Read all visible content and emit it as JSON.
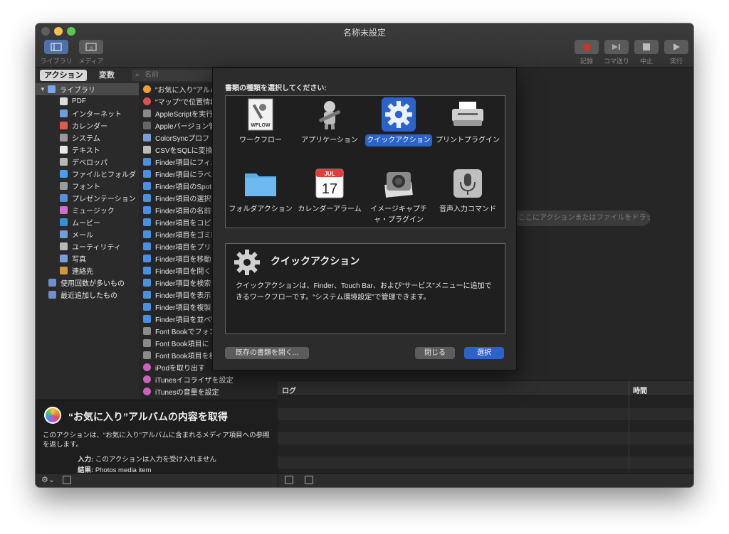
{
  "window": {
    "title": "名称未設定"
  },
  "toolbar": {
    "library_label": "ライブラリ",
    "media_label": "メディア",
    "record_label": "記録",
    "step_label": "コマ送り",
    "stop_label": "中止",
    "run_label": "実行"
  },
  "sidebar": {
    "tab_actions": "アクション",
    "tab_variables": "変数",
    "search_placeholder": "名前",
    "library": [
      {
        "label": "ライブラリ",
        "color": "#7aa6e8"
      },
      {
        "label": "PDF",
        "color": "#dddddd"
      },
      {
        "label": "インターネット",
        "color": "#6f9fd8"
      },
      {
        "label": "カレンダー",
        "color": "#e05a4f"
      },
      {
        "label": "システム",
        "color": "#9a9a9a"
      },
      {
        "label": "テキスト",
        "color": "#e8e8e8"
      },
      {
        "label": "デベロッパ",
        "color": "#b8b8b8"
      },
      {
        "label": "ファイルとフォルダ",
        "color": "#4aa0e8"
      },
      {
        "label": "フォント",
        "color": "#9a9a9a"
      },
      {
        "label": "プレゼンテーション",
        "color": "#5b8fd0"
      },
      {
        "label": "ミュージック",
        "color": "#d06fd0"
      },
      {
        "label": "ムービー",
        "color": "#3a8fd0"
      },
      {
        "label": "メール",
        "color": "#6f9fd8"
      },
      {
        "label": "ユーティリティ",
        "color": "#b8b8b8"
      },
      {
        "label": "写真",
        "color": "#7a9fd8"
      },
      {
        "label": "連絡先",
        "color": "#c89a4a"
      },
      {
        "label": "使用回数が多いもの",
        "color": "#6f8fc8"
      },
      {
        "label": "最近追加したもの",
        "color": "#6f8fc8"
      }
    ],
    "actions": [
      "\"お気に入り\"アルバ",
      "\"マップ\"で位置情報",
      "AppleScriptを実行",
      "Appleバージョン管",
      "ColorSyncプロフ",
      "CSVをSQLに変換",
      "Finder項目にフィル",
      "Finder項目にラベル",
      "Finder項目のSpot",
      "Finder項目の選択を",
      "Finder項目の名前を",
      "Finder項目をコピー",
      "Finder項目をゴミ箱",
      "Finder項目をプリン",
      "Finder項目を移動",
      "Finder項目を開く",
      "Finder項目を検索",
      "Finder項目を表示",
      "Finder項目を複製",
      "Finder項目を並べ替",
      "Font Bookでフォン",
      "Font Book項目に",
      "Font Book項目を検",
      "iPodを取り出す",
      "iTunesイコライザを設定",
      "iTunesの音量を設定"
    ]
  },
  "description": {
    "title": "“お気に入り”アルバムの内容を取得",
    "body": "このアクションは、“お気に入り”アルバムに含まれるメディア項目への参照を返します。",
    "input_label": "入力:",
    "input_value": "このアクションは入力を受け入れません",
    "result_label": "結果:",
    "result_value": "Photos media item"
  },
  "workflow": {
    "drop_hint": "ここにアクションまたはファイルをドラッグしてください。"
  },
  "log": {
    "col_log": "ログ",
    "col_time": "時間"
  },
  "sheet": {
    "prompt": "書類の種類を選択してください:",
    "types": [
      {
        "label": "ワークフロー",
        "icon": "workflow-icon",
        "selected": false
      },
      {
        "label": "アプリケーション",
        "icon": "application-icon",
        "selected": false
      },
      {
        "label": "クイックアクション",
        "icon": "gear-icon",
        "selected": true
      },
      {
        "label": "プリントプラグイン",
        "icon": "printer-icon",
        "selected": false
      },
      {
        "label": "フォルダアクション",
        "icon": "folder-icon",
        "selected": false
      },
      {
        "label": "カレンダーアラーム",
        "icon": "calendar-icon",
        "selected": false
      },
      {
        "label": "イメージキャプチャ・プラグイン",
        "icon": "camera-icon",
        "selected": false
      },
      {
        "label": "音声入力コマンド",
        "icon": "microphone-icon",
        "selected": false
      }
    ],
    "calendar_month": "JUL",
    "calendar_day": "17",
    "wflow_text": "WFLOW",
    "info_title": "クイックアクション",
    "info_body": "クイックアクションは、Finder、Touch Bar、および“サービス”メニューに追加できるワークフローです。“システム環境設定”で管理できます。",
    "open_existing": "既存の書類を開く...",
    "close": "閉じる",
    "choose": "選択"
  }
}
